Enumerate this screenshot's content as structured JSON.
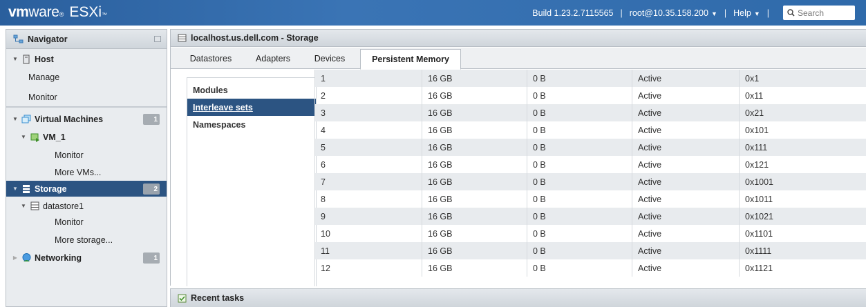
{
  "app": {
    "brand_vm": "vm",
    "brand_ware": "ware",
    "brand_product": "ESXi",
    "build": "Build 1.23.2.7115565",
    "user": "root@10.35.158.200",
    "help": "Help",
    "search_placeholder": "Search",
    "separator": "|"
  },
  "navigator": {
    "title": "Navigator",
    "host": {
      "label": "Host",
      "children": [
        "Manage",
        "Monitor"
      ]
    },
    "virtual_machines": {
      "label": "Virtual Machines",
      "count": "1",
      "vm": {
        "label": "VM_1",
        "children": [
          "Monitor"
        ]
      },
      "more": "More VMs..."
    },
    "storage": {
      "label": "Storage",
      "count": "2",
      "datastore": {
        "label": "datastore1",
        "children": [
          "Monitor"
        ]
      },
      "more": "More storage..."
    },
    "networking": {
      "label": "Networking",
      "count": "1"
    }
  },
  "main": {
    "title": "localhost.us.dell.com - Storage",
    "tabs": [
      "Datastores",
      "Adapters",
      "Devices",
      "Persistent Memory"
    ],
    "active_tab": "Persistent Memory",
    "subnav": [
      "Modules",
      "Interleave sets",
      "Namespaces"
    ],
    "active_subnav": "Interleave sets",
    "rows": [
      [
        "1",
        "16 GB",
        "0 B",
        "Active",
        "0x1"
      ],
      [
        "2",
        "16 GB",
        "0 B",
        "Active",
        "0x11"
      ],
      [
        "3",
        "16 GB",
        "0 B",
        "Active",
        "0x21"
      ],
      [
        "4",
        "16 GB",
        "0 B",
        "Active",
        "0x101"
      ],
      [
        "5",
        "16 GB",
        "0 B",
        "Active",
        "0x111"
      ],
      [
        "6",
        "16 GB",
        "0 B",
        "Active",
        "0x121"
      ],
      [
        "7",
        "16 GB",
        "0 B",
        "Active",
        "0x1001"
      ],
      [
        "8",
        "16 GB",
        "0 B",
        "Active",
        "0x1011"
      ],
      [
        "9",
        "16 GB",
        "0 B",
        "Active",
        "0x1021"
      ],
      [
        "10",
        "16 GB",
        "0 B",
        "Active",
        "0x1101"
      ],
      [
        "11",
        "16 GB",
        "0 B",
        "Active",
        "0x1111"
      ],
      [
        "12",
        "16 GB",
        "0 B",
        "Active",
        "0x1121"
      ]
    ]
  },
  "recent_tasks": {
    "title": "Recent tasks"
  },
  "colors": {
    "topbar": "#2f6aaa",
    "selected": "#2c5482",
    "badge": "#a6acb2"
  }
}
